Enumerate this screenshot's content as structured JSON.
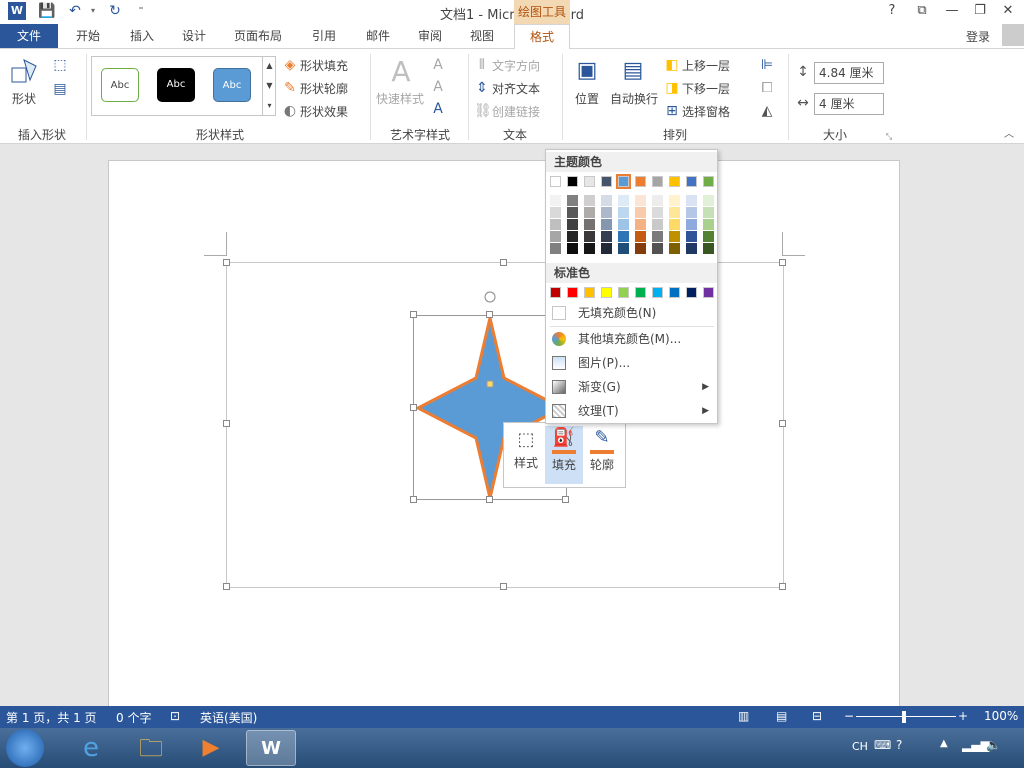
{
  "title": "文档1 - Microsoft Word",
  "context_tab_label": "绘图工具",
  "help": "?",
  "tabs": {
    "file": "文件",
    "items": [
      "开始",
      "插入",
      "设计",
      "页面布局",
      "引用",
      "邮件",
      "审阅",
      "视图"
    ],
    "active": "格式"
  },
  "login": "登录",
  "ribbon": {
    "insert_shapes": {
      "shape_label": "形状",
      "group": "插入形状"
    },
    "shape_styles": {
      "gallery": [
        "Abc",
        "Abc",
        "Abc"
      ],
      "fill": "形状填充",
      "outline": "形状轮廓",
      "effects": "形状效果",
      "group": "形状样式"
    },
    "wordart": {
      "quick_styles": "快速样式",
      "group": "艺术字样式"
    },
    "text": {
      "direction": "文字方向",
      "align": "对齐文本",
      "link": "创建链接",
      "group": "文本"
    },
    "arrange": {
      "position": "位置",
      "wrap": "自动换行",
      "forward": "上移一层",
      "backward": "下移一层",
      "selection_pane": "选择窗格",
      "group": "排列"
    },
    "size": {
      "height": "4.84 厘米",
      "width": "4 厘米",
      "group": "大小"
    }
  },
  "mini_toolbar": {
    "style": "样式",
    "fill": "填充",
    "outline": "轮廓"
  },
  "fill_menu": {
    "theme_header": "主题颜色",
    "standard_header": "标准色",
    "theme_colors": [
      "#ffffff",
      "#000000",
      "#e7e6e6",
      "#44546a",
      "#5b9bd5",
      "#ed7d31",
      "#a5a5a5",
      "#ffc000",
      "#4472c4",
      "#70ad47"
    ],
    "theme_shades": [
      [
        "#f2f2f2",
        "#d9d9d9",
        "#bfbfbf",
        "#a6a6a6",
        "#808080"
      ],
      [
        "#808080",
        "#595959",
        "#404040",
        "#262626",
        "#0d0d0d"
      ],
      [
        "#d0cece",
        "#aeabab",
        "#757171",
        "#3a3838",
        "#171616"
      ],
      [
        "#d6dce5",
        "#adb9ca",
        "#8497b0",
        "#333f50",
        "#222a35"
      ],
      [
        "#deebf7",
        "#bdd7ee",
        "#9dc3e6",
        "#2e75b6",
        "#1f4e79"
      ],
      [
        "#fbe5d6",
        "#f8cbad",
        "#f4b183",
        "#c55a11",
        "#843c0c"
      ],
      [
        "#ededed",
        "#dbdbdb",
        "#c9c9c9",
        "#7b7b7b",
        "#525252"
      ],
      [
        "#fff2cc",
        "#ffe699",
        "#ffd966",
        "#bf9000",
        "#7f6000"
      ],
      [
        "#dae3f3",
        "#b4c7e7",
        "#8faadc",
        "#2f5597",
        "#203864"
      ],
      [
        "#e2f0d9",
        "#c5e0b4",
        "#a9d18e",
        "#548235",
        "#385723"
      ]
    ],
    "standard_colors": [
      "#c00000",
      "#ff0000",
      "#ffc000",
      "#ffff00",
      "#92d050",
      "#00b050",
      "#00b0f0",
      "#0070c0",
      "#002060",
      "#7030a0"
    ],
    "no_fill": "无填充颜色(N)",
    "more_colors": "其他填充颜色(M)...",
    "picture": "图片(P)...",
    "gradient": "渐变(G)",
    "texture": "纹理(T)"
  },
  "statusbar": {
    "page": "第 1 页，共 1 页",
    "words": "0 个字",
    "language": "英语(美国)",
    "zoom": "100%"
  },
  "taskbar": {
    "lang": "CH"
  },
  "colors": {
    "accent": "#2b579a",
    "context": "#b2520f",
    "shape_fill": "#5b9bd5",
    "shape_outline": "#ed7d31"
  }
}
